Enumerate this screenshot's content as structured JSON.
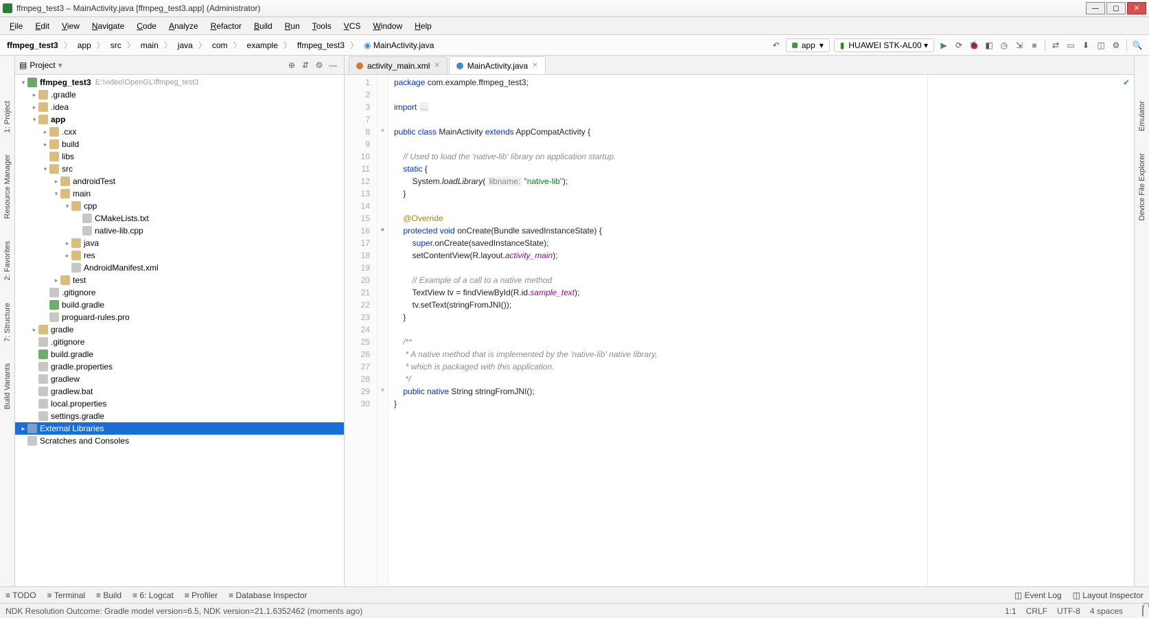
{
  "titlebar": {
    "text": "ffmpeg_test3 – MainActivity.java [ffmpeg_test3.app] (Administrator)"
  },
  "menu": [
    "File",
    "Edit",
    "View",
    "Navigate",
    "Code",
    "Analyze",
    "Refactor",
    "Build",
    "Run",
    "Tools",
    "VCS",
    "Window",
    "Help"
  ],
  "breadcrumb": [
    "ffmpeg_test3",
    "app",
    "src",
    "main",
    "java",
    "com",
    "example",
    "ffmpeg_test3"
  ],
  "breadcrumb_file": "MainActivity.java",
  "run_config": {
    "module": "app",
    "device": "HUAWEI STK-AL00 ▾"
  },
  "project_panel": {
    "title": "Project"
  },
  "tree": [
    {
      "depth": 0,
      "arrow": "▾",
      "ico": "proj",
      "label": "ffmpeg_test3",
      "path": "E:\\video\\OpenGL\\ffmpeg_test3",
      "bold": true
    },
    {
      "depth": 1,
      "arrow": "▸",
      "ico": "folder",
      "label": ".gradle"
    },
    {
      "depth": 1,
      "arrow": "▸",
      "ico": "folder",
      "label": ".idea"
    },
    {
      "depth": 1,
      "arrow": "▾",
      "ico": "folder-open",
      "label": "app",
      "bold": true
    },
    {
      "depth": 2,
      "arrow": "▸",
      "ico": "folder",
      "label": ".cxx"
    },
    {
      "depth": 2,
      "arrow": "▸",
      "ico": "folder",
      "label": "build"
    },
    {
      "depth": 2,
      "arrow": "",
      "ico": "folder",
      "label": "libs"
    },
    {
      "depth": 2,
      "arrow": "▾",
      "ico": "folder-open",
      "label": "src"
    },
    {
      "depth": 3,
      "arrow": "▸",
      "ico": "folder",
      "label": "androidTest"
    },
    {
      "depth": 3,
      "arrow": "▾",
      "ico": "folder-open",
      "label": "main"
    },
    {
      "depth": 4,
      "arrow": "▾",
      "ico": "folder-open",
      "label": "cpp"
    },
    {
      "depth": 5,
      "arrow": "",
      "ico": "file",
      "label": "CMakeLists.txt"
    },
    {
      "depth": 5,
      "arrow": "",
      "ico": "file",
      "label": "native-lib.cpp"
    },
    {
      "depth": 4,
      "arrow": "▸",
      "ico": "folder",
      "label": "java"
    },
    {
      "depth": 4,
      "arrow": "▸",
      "ico": "folder",
      "label": "res"
    },
    {
      "depth": 4,
      "arrow": "",
      "ico": "file",
      "label": "AndroidManifest.xml"
    },
    {
      "depth": 3,
      "arrow": "▸",
      "ico": "folder",
      "label": "test"
    },
    {
      "depth": 2,
      "arrow": "",
      "ico": "file",
      "label": ".gitignore"
    },
    {
      "depth": 2,
      "arrow": "",
      "ico": "gradle",
      "label": "build.gradle"
    },
    {
      "depth": 2,
      "arrow": "",
      "ico": "file",
      "label": "proguard-rules.pro"
    },
    {
      "depth": 1,
      "arrow": "▸",
      "ico": "folder",
      "label": "gradle"
    },
    {
      "depth": 1,
      "arrow": "",
      "ico": "file",
      "label": ".gitignore"
    },
    {
      "depth": 1,
      "arrow": "",
      "ico": "gradle",
      "label": "build.gradle"
    },
    {
      "depth": 1,
      "arrow": "",
      "ico": "file",
      "label": "gradle.properties"
    },
    {
      "depth": 1,
      "arrow": "",
      "ico": "file",
      "label": "gradlew"
    },
    {
      "depth": 1,
      "arrow": "",
      "ico": "file",
      "label": "gradlew.bat"
    },
    {
      "depth": 1,
      "arrow": "",
      "ico": "file",
      "label": "local.properties"
    },
    {
      "depth": 1,
      "arrow": "",
      "ico": "file",
      "label": "settings.gradle"
    },
    {
      "depth": 0,
      "arrow": "▸",
      "ico": "lib",
      "label": "External Libraries",
      "selected": true
    },
    {
      "depth": 0,
      "arrow": "",
      "ico": "file",
      "label": "Scratches and Consoles"
    }
  ],
  "tabs": [
    {
      "label": "activity_main.xml",
      "kind": "xml",
      "active": false
    },
    {
      "label": "MainActivity.java",
      "kind": "java",
      "active": true
    }
  ],
  "code": {
    "lines": [
      {
        "n": 1,
        "html": "<span class='kw'>package</span> com.example.ffmpeg_test3;"
      },
      {
        "n": 2,
        "html": ""
      },
      {
        "n": 3,
        "html": "<span class='kw'>import</span> <span class='hint'>...</span>"
      },
      {
        "n": 7,
        "html": ""
      },
      {
        "n": 8,
        "html": "<span class='kw'>public class</span> MainActivity <span class='kw'>extends</span> AppCompatActivity {"
      },
      {
        "n": 9,
        "html": ""
      },
      {
        "n": 10,
        "html": "    <span class='cm'>// Used to load the 'native-lib' library on application startup.</span>"
      },
      {
        "n": 11,
        "html": "    <span class='kw'>static</span> {"
      },
      {
        "n": 12,
        "html": "        System.<span style='font-style:italic'>loadLibrary</span>( <span class='hint'>libname:</span> <span class='str'>\"native-lib\"</span>);"
      },
      {
        "n": 13,
        "html": "    }"
      },
      {
        "n": 14,
        "html": ""
      },
      {
        "n": 15,
        "html": "    <span class='an'>@Override</span>"
      },
      {
        "n": 16,
        "html": "    <span class='kw'>protected void</span> onCreate(Bundle savedInstanceState) {"
      },
      {
        "n": 17,
        "html": "        <span class='kw'>super</span>.onCreate(savedInstanceState);"
      },
      {
        "n": 18,
        "html": "        setContentView(R.layout.<span class='fld'>activity_main</span>);"
      },
      {
        "n": 19,
        "html": ""
      },
      {
        "n": 20,
        "html": "        <span class='cm'>// Example of a call to a native method</span>"
      },
      {
        "n": 21,
        "html": "        TextView tv = findViewById(R.id.<span class='fld'>sample_text</span>);"
      },
      {
        "n": 22,
        "html": "        tv.setText(stringFromJNI());"
      },
      {
        "n": 23,
        "html": "    }"
      },
      {
        "n": 24,
        "html": ""
      },
      {
        "n": 25,
        "html": "    <span class='cm'>/**</span>"
      },
      {
        "n": 26,
        "html": "<span class='cm'>     * A native method that is implemented by the 'native-lib' native library,</span>"
      },
      {
        "n": 27,
        "html": "<span class='cm'>     * which is packaged with this application.</span>"
      },
      {
        "n": 28,
        "html": "<span class='cm'>     */</span>"
      },
      {
        "n": 29,
        "html": "    <span class='kw'>public native</span> String stringFromJNI();"
      },
      {
        "n": 30,
        "html": "}"
      }
    ]
  },
  "left_strips": [
    "1: Project",
    "Resource Manager"
  ],
  "left_strips_bottom": [
    "2: Favorites",
    "7: Structure",
    "Build Variants"
  ],
  "right_strips": [
    "Emulator",
    "Device File Explorer"
  ],
  "bottom_tools": [
    "TODO",
    "Terminal",
    "Build",
    "6: Logcat",
    "Profiler",
    "Database Inspector"
  ],
  "bottom_right": [
    "Event Log",
    "Layout Inspector"
  ],
  "status": {
    "msg": "NDK Resolution Outcome: Gradle model version=6.5, NDK version=21.1.6352462 (moments ago)",
    "pos": "1:1",
    "eol": "CRLF",
    "enc": "UTF-8",
    "indent": "4 spaces"
  }
}
